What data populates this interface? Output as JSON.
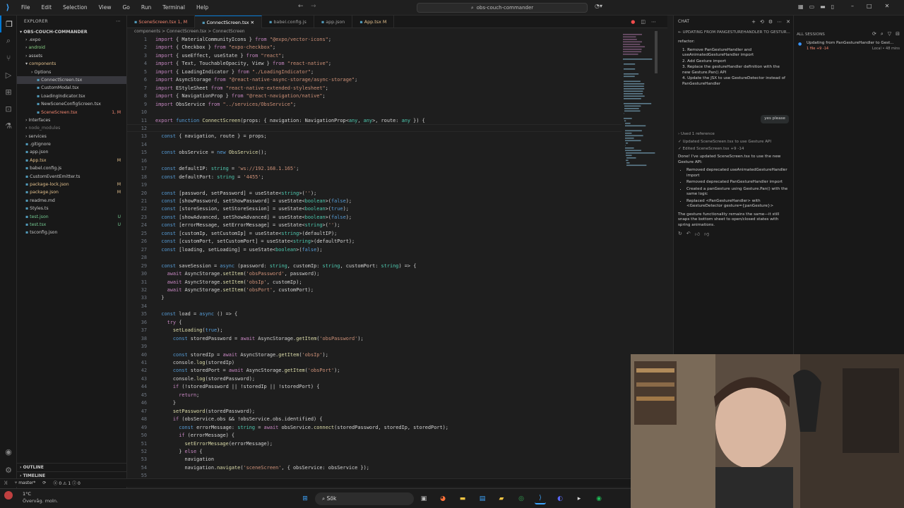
{
  "menu": [
    "File",
    "Edit",
    "Selection",
    "View",
    "Go",
    "Run",
    "Terminal",
    "Help"
  ],
  "search_text": "obs-couch-commander",
  "explorer": {
    "header": "EXPLORER",
    "project": "OBS-COUCH-COMMANDER",
    "tree": [
      {
        "label": ".expo",
        "indent": 1,
        "type": "folder",
        "color": "#c5c5c5"
      },
      {
        "label": "android",
        "indent": 1,
        "type": "folder",
        "color": "#89d185"
      },
      {
        "label": "assets",
        "indent": 1,
        "type": "folder",
        "color": "#c5c5c5"
      },
      {
        "label": "components",
        "indent": 1,
        "type": "folder-open",
        "color": "#e2c08d"
      },
      {
        "label": "Options",
        "indent": 2,
        "type": "folder",
        "color": "#c5c5c5"
      },
      {
        "label": "ConnectScreen.tsx",
        "indent": 3,
        "type": "file",
        "color": "#c5c5c5",
        "selected": true
      },
      {
        "label": "CustomModal.tsx",
        "indent": 3,
        "type": "file",
        "color": "#c5c5c5"
      },
      {
        "label": "LoadingIndicator.tsx",
        "indent": 3,
        "type": "file",
        "color": "#c5c5c5"
      },
      {
        "label": "NewSceneConfigScreen.tsx",
        "indent": 3,
        "type": "file",
        "color": "#c5c5c5"
      },
      {
        "label": "SceneScreen.tsx",
        "indent": 3,
        "type": "file",
        "color": "#f48771",
        "badge": "1, M"
      },
      {
        "label": "Interfaces",
        "indent": 1,
        "type": "folder",
        "color": "#c5c5c5"
      },
      {
        "label": "node_modules",
        "indent": 1,
        "type": "folder",
        "color": "#7a7a7a"
      },
      {
        "label": "services",
        "indent": 1,
        "type": "folder",
        "color": "#c5c5c5"
      },
      {
        "label": ".gitignore",
        "indent": 1,
        "type": "file",
        "color": "#c5c5c5"
      },
      {
        "label": "app.json",
        "indent": 1,
        "type": "file",
        "color": "#c5c5c5"
      },
      {
        "label": "App.tsx",
        "indent": 1,
        "type": "file",
        "color": "#e2c08d",
        "badge": "M"
      },
      {
        "label": "babel.config.js",
        "indent": 1,
        "type": "file",
        "color": "#c5c5c5"
      },
      {
        "label": "CustomEventEmitter.ts",
        "indent": 1,
        "type": "file",
        "color": "#c5c5c5"
      },
      {
        "label": "package-lock.json",
        "indent": 1,
        "type": "file",
        "color": "#e2c08d",
        "badge": "M"
      },
      {
        "label": "package.json",
        "indent": 1,
        "type": "file",
        "color": "#e2c08d",
        "badge": "M"
      },
      {
        "label": "readme.md",
        "indent": 1,
        "type": "file",
        "color": "#c5c5c5"
      },
      {
        "label": "Styles.ts",
        "indent": 1,
        "type": "file",
        "color": "#c5c5c5"
      },
      {
        "label": "test.json",
        "indent": 1,
        "type": "file",
        "color": "#73c991",
        "badge": "U"
      },
      {
        "label": "test.tsx",
        "indent": 1,
        "type": "file",
        "color": "#73c991",
        "badge": "U"
      },
      {
        "label": "tsconfig.json",
        "indent": 1,
        "type": "file",
        "color": "#c5c5c5"
      }
    ],
    "outline": "OUTLINE",
    "timeline": "TIMELINE"
  },
  "tabs": [
    {
      "label": "SceneScreen.tsx",
      "suffix": "1, M",
      "active": false,
      "color": "#f48771"
    },
    {
      "label": "ConnectScreen.tsx",
      "suffix": "",
      "active": true,
      "color": "#ffffff"
    },
    {
      "label": "babel.config.js",
      "suffix": "",
      "active": false,
      "color": "#9d9d9d"
    },
    {
      "label": "app.json",
      "suffix": "",
      "active": false,
      "color": "#9d9d9d"
    },
    {
      "label": "App.tsx",
      "suffix": "M",
      "active": false,
      "color": "#e2c08d"
    }
  ],
  "breadcrumbs": "components > ConnectScreen.tsx > ConnectScreen",
  "code": [
    [
      1,
      "import { MaterialCommunityIcons } from \"@expo/vector-icons\";"
    ],
    [
      2,
      "import { Checkbox } from \"expo-checkbox\";"
    ],
    [
      3,
      "import { useEffect, useState } from \"react\";"
    ],
    [
      4,
      "import { Text, TouchableOpacity, View } from \"react-native\";"
    ],
    [
      5,
      "import { LoadingIndicator } from \"./LoadingIndicator\";"
    ],
    [
      6,
      "import AsyncStorage from \"@react-native-async-storage/async-storage\";"
    ],
    [
      7,
      "import EStyleSheet from \"react-native-extended-stylesheet\";"
    ],
    [
      8,
      "import { NavigationProp } from \"@react-navigation/native\";"
    ],
    [
      9,
      "import ObsService from \"../services/ObsService\";"
    ],
    [
      10,
      ""
    ],
    [
      11,
      "export function ConnectScreen(props: { navigation: NavigationProp<any, any>, route: any }) {"
    ],
    [
      12,
      ""
    ],
    [
      13,
      "  const { navigation, route } = props;"
    ],
    [
      14,
      ""
    ],
    [
      15,
      "  const obsService = new ObsService();"
    ],
    [
      16,
      ""
    ],
    [
      17,
      "  const defaultIP: string = 'ws://192.168.1.165';"
    ],
    [
      18,
      "  const defaultPort: string = '4455';"
    ],
    [
      19,
      ""
    ],
    [
      20,
      "  const [password, setPassword] = useState<string>('');"
    ],
    [
      21,
      "  const [showPassword, setShowPassword] = useState<boolean>(false);"
    ],
    [
      22,
      "  const [storeSession, setStoreSession] = useState<boolean>(true);"
    ],
    [
      23,
      "  const [showAdvanced, setShowAdvanced] = useState<boolean>(false);"
    ],
    [
      24,
      "  const [errorMessage, setErrorMessage] = useState<string>('');"
    ],
    [
      25,
      "  const [customIp, setCustomIp] = useState<string>(defaultIP);"
    ],
    [
      26,
      "  const [customPort, setCustomPort] = useState<string>(defaultPort);"
    ],
    [
      27,
      "  const [loading, setLoading] = useState<boolean>(false);"
    ],
    [
      28,
      ""
    ],
    [
      29,
      "  const saveSession = async (password: string, customIp: string, customPort: string) => {"
    ],
    [
      30,
      "    await AsyncStorage.setItem('obsPassword', password);"
    ],
    [
      31,
      "    await AsyncStorage.setItem('obsIp', customIp);"
    ],
    [
      32,
      "    await AsyncStorage.setItem('obsPort', customPort);"
    ],
    [
      33,
      "  }"
    ],
    [
      34,
      ""
    ],
    [
      35,
      "  const load = async () => {"
    ],
    [
      36,
      "    try {"
    ],
    [
      37,
      "      setLoading(true);"
    ],
    [
      38,
      "      const storedPassword = await AsyncStorage.getItem('obsPassword');"
    ],
    [
      39,
      ""
    ],
    [
      40,
      "      const storedIp = await AsyncStorage.getItem('obsIp');"
    ],
    [
      41,
      "      console.log(storedIp)"
    ],
    [
      42,
      "      const storedPort = await AsyncStorage.getItem('obsPort');"
    ],
    [
      43,
      "      console.log(storedPassword);"
    ],
    [
      44,
      "      if (!storedPassword || !storedIp || !storedPort) {"
    ],
    [
      45,
      "        return;"
    ],
    [
      46,
      "      }"
    ],
    [
      47,
      "      setPassword(storedPassword);"
    ],
    [
      48,
      "      if (obsService.obs && !obsService.obs.identified) {"
    ],
    [
      49,
      "        const errorMessage: string = await obsService.connect(storedPassword, storedIp, storedPort);"
    ],
    [
      50,
      "        if (errorMessage) {"
    ],
    [
      51,
      "          setErrorMessage(errorMessage);"
    ],
    [
      52,
      "        } else {"
    ],
    [
      53,
      "          navigation"
    ],
    [
      54,
      "          navigation.navigate('sceneScreen', { obsService: obsService });"
    ],
    [
      55,
      ""
    ]
  ],
  "chat": {
    "header": "CHAT",
    "title": "UPDATING FROM PANGESTUREHANDLER TO GESTUR...",
    "refactor": "refactor:",
    "steps": [
      "1. Remove  PanGestureHandler  and useAnimatedGestureHandler  import",
      "2. Add  Gesture  import",
      "3. Replace the  gestureHandler  definition with the new  Gesture.Pan()  API",
      "4. Update the JSX to use  GestureDetector instead of  PanGestureHandler"
    ],
    "user_msg": "yes please",
    "used_ref": "Used 1 reference",
    "updated": "Updated SceneScreen.tsx to use Gesture API",
    "edited": "Edited  SceneScreen.tsx +9 -14",
    "done": "Done! I've updated SceneScreen.tsx to use the new Gesture API:",
    "bullets": [
      "Removed deprecated useAnimatedGestureHandler import",
      "Removed deprecated PanGestureHandler import",
      "Created a panGesture using Gesture.Pan() with the same logic",
      "Replaced <PanGestureHandler> with <GestureDetector gesture={panGesture}>"
    ],
    "summary": "The gesture functionality remains the same—it still snaps the bottom sheet to open/closed states with spring animations."
  },
  "sessions": {
    "header": "ALL SESSIONS",
    "item_title": "Updating from PanGestureHandler to Gest...",
    "item_meta": "1 file +9 -14",
    "item_time": "Local • 48 mins"
  },
  "status": {
    "branch": "master*",
    "problems": "0 ⚠ 1 ⓘ 0"
  },
  "weather": {
    "temp": "1°C",
    "desc": "Övervåg. moln."
  },
  "taskbar_search": "Sök"
}
